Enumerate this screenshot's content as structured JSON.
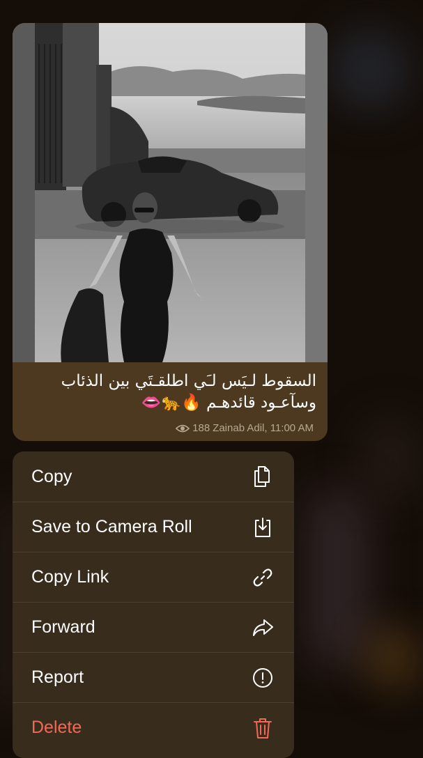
{
  "message": {
    "caption_line1": "السقوط لـيَس لـَي اطلقـتَي بين الذئاب",
    "caption_line2": "وسآعـود قائدهـم 🔥🐆👄",
    "views": "188",
    "author_time": "Zainab Adil, 11:00 AM"
  },
  "menu": {
    "items": [
      {
        "label": "Copy",
        "icon": "copy-icon"
      },
      {
        "label": "Save to Camera Roll",
        "icon": "save-download-icon"
      },
      {
        "label": "Copy Link",
        "icon": "link-icon"
      },
      {
        "label": "Forward",
        "icon": "forward-arrow-icon"
      },
      {
        "label": "Report",
        "icon": "exclamation-circle-icon"
      },
      {
        "label": "Delete",
        "icon": "trash-icon"
      }
    ]
  },
  "colors": {
    "bubble": "#4c3920",
    "menu_bg": "#3a2d1e",
    "danger": "#f26a57",
    "background": "#140d08"
  }
}
